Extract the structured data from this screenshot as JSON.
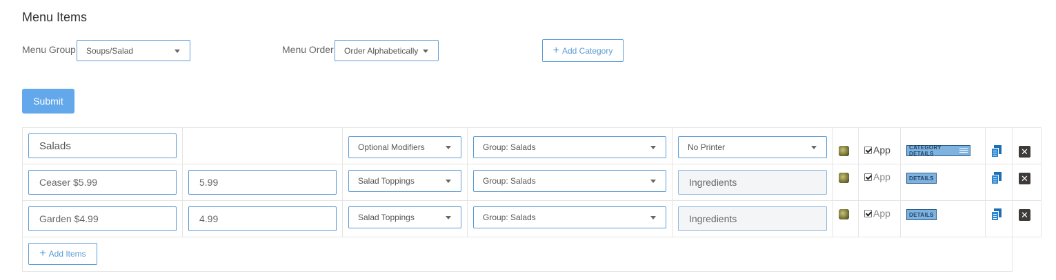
{
  "page": {
    "title": "Menu Items"
  },
  "filters": {
    "menu_group_label": "Menu Group",
    "menu_group_value": "Soups/Salad",
    "menu_order_label": "Menu Order",
    "menu_order_value": "Order Alphabetically",
    "add_category_label": "Add Category"
  },
  "submit_label": "Submit",
  "category_row": {
    "name": "Salads",
    "modifiers": "Optional Modifiers",
    "group": "Group: Salads",
    "printer": "No Printer",
    "app_label": "App",
    "app_checked": true,
    "details_label": "CATEGORY DETAILS"
  },
  "items": [
    {
      "name": "Ceaser $5.99",
      "price": "5.99",
      "modifiers": "Salad Toppings",
      "group": "Group: Salads",
      "ingredients_placeholder": "Ingredients",
      "app_label": "App",
      "app_checked": true,
      "details_label": "DETAILS"
    },
    {
      "name": "Garden $4.99",
      "price": "4.99",
      "modifiers": "Salad Toppings",
      "group": "Group: Salads",
      "ingredients_placeholder": "Ingredients",
      "app_label": "App",
      "app_checked": true,
      "details_label": "DETAILS"
    }
  ],
  "add_items_label": "Add Items",
  "icons": {
    "thumbnail": "food-thumbnail-icon",
    "copy": "copy-icon",
    "delete": "delete-icon",
    "add": "plus-icon"
  },
  "colors": {
    "accent": "#5b9bd5",
    "submit": "#62a8ea",
    "delete": "#3d3a38",
    "copy": "#2e86cf"
  }
}
